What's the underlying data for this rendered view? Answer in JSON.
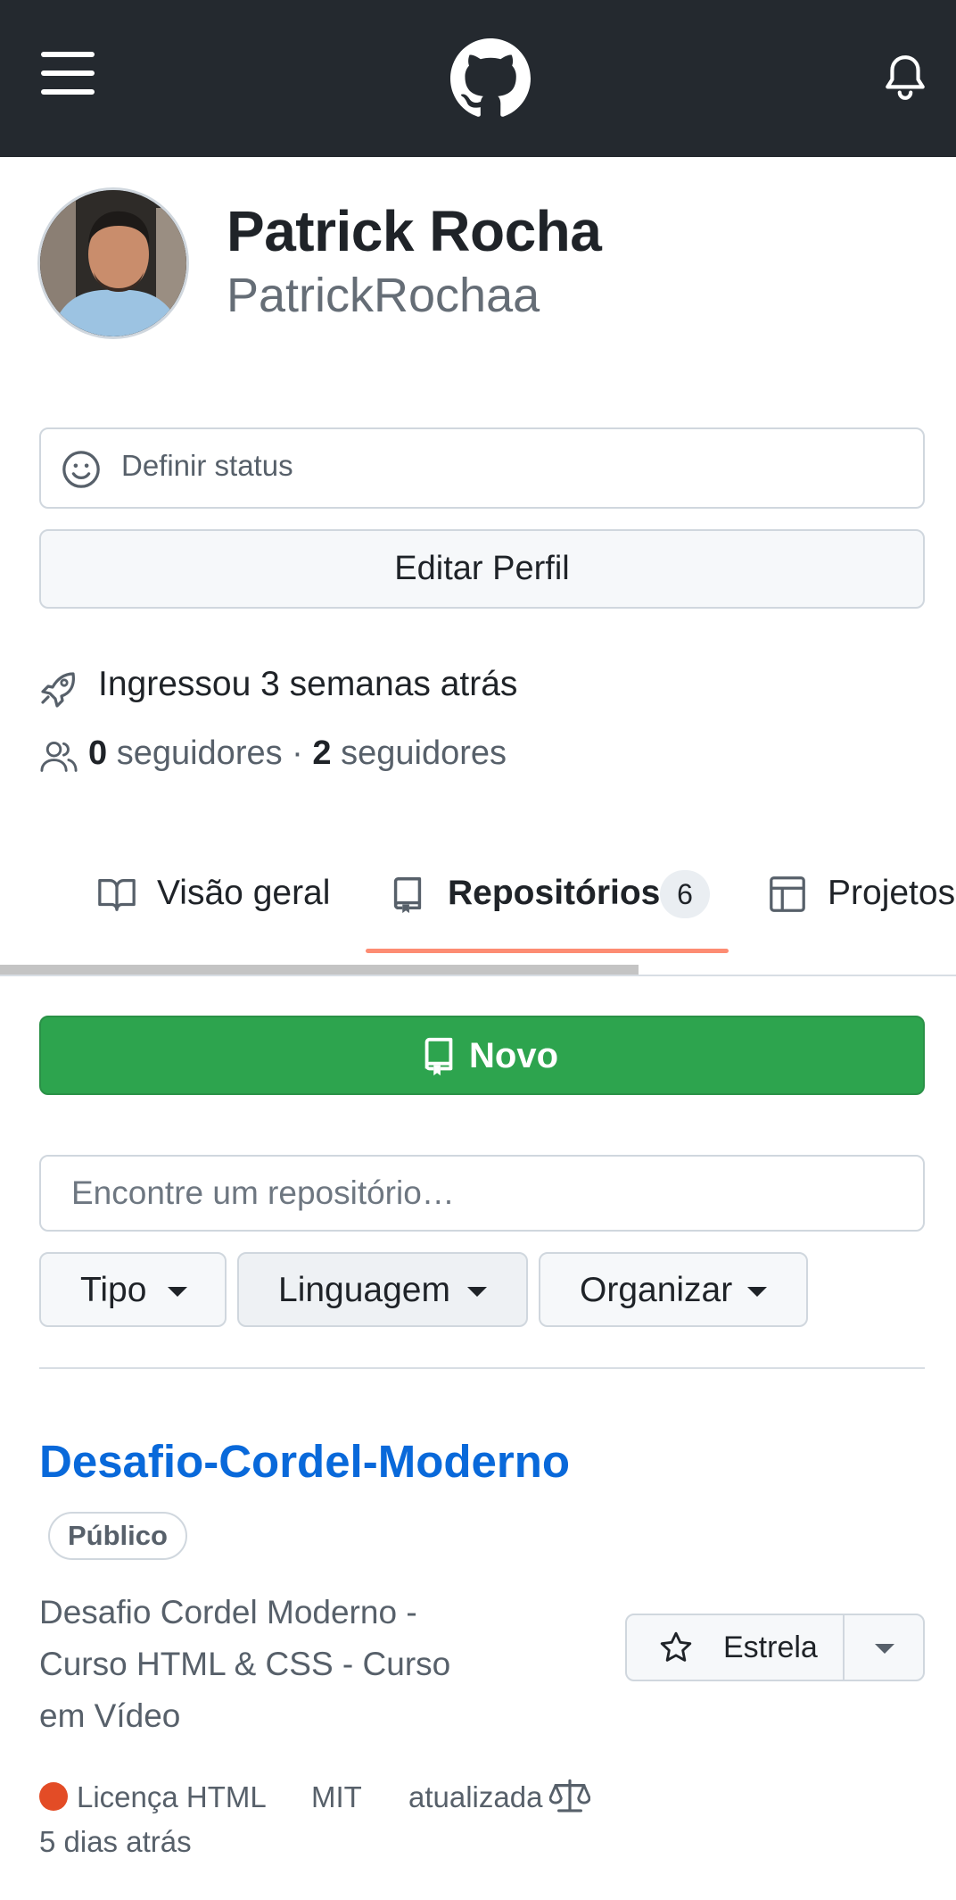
{
  "profile": {
    "full_name": "Patrick Rocha",
    "username": "PatrickRochaa",
    "status_label": "Definir status",
    "edit_label": "Editar Perfil",
    "joined": "Ingressou 3 semanas atrás",
    "followers_count": "0",
    "followers_label": "seguidores",
    "separator": "·",
    "following_count": "2",
    "following_label": "seguidores"
  },
  "tabs": {
    "overview": "Visão geral",
    "repositories": "Repositórios",
    "repositories_count": "6",
    "projects": "Projetos"
  },
  "repos": {
    "new_label": "Novo",
    "search_placeholder": "Encontre um repositório…",
    "filters": {
      "type": "Tipo",
      "language": "Linguagem",
      "sort": "Organizar"
    },
    "items": [
      {
        "name": "Desafio-Cordel-Moderno",
        "visibility": "Público",
        "description": "Desafio Cordel Moderno - Curso HTML & CSS - Curso em Vídeo",
        "language_text": "Licença HTML",
        "language_color": "#e34c26",
        "license": "MIT",
        "updated_label": "atualizada",
        "updated_ago": "5 dias atrás",
        "star_label": "Estrela"
      }
    ]
  },
  "colors": {
    "header_bg": "#24292f",
    "primary_green": "#2da44e",
    "link_blue": "#0969da",
    "tab_underline": "#fd8c73"
  },
  "icons": [
    "hamburger-menu-icon",
    "github-logo-icon",
    "bell-icon",
    "smiley-icon",
    "rocket-icon",
    "people-icon",
    "book-icon",
    "repo-icon",
    "table-icon",
    "star-icon",
    "law-icon",
    "chevron-down-icon"
  ]
}
